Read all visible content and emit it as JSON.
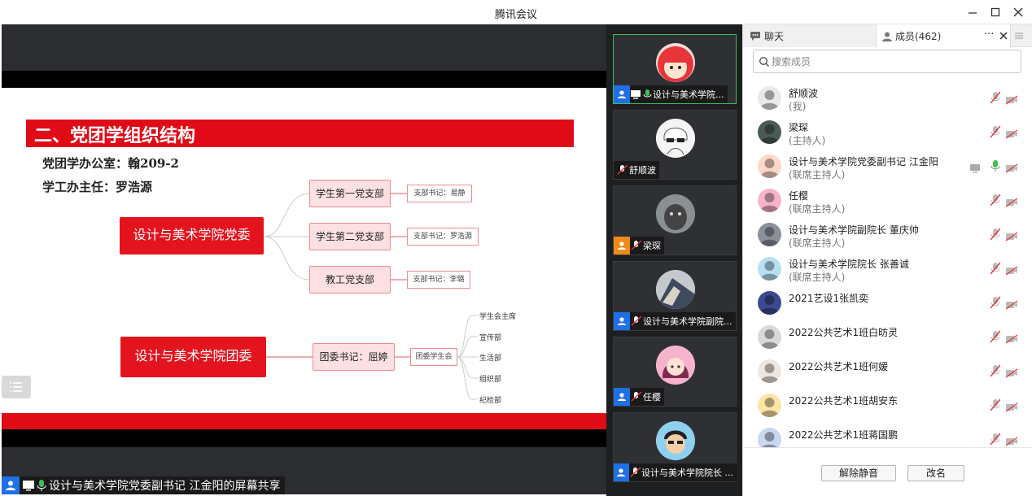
{
  "window": {
    "title": "腾讯会议"
  },
  "slide": {
    "heading": "二、党团学组织结构",
    "office": "党团学办公室：翰209-2",
    "director": "学工办主任：罗浩源",
    "party_committee": "设计与美术学院党委",
    "youth_league": "设计与美术学院团委",
    "branches": [
      {
        "name": "学生第一党支部",
        "secretary": "支部书记：易静"
      },
      {
        "name": "学生第二党支部",
        "secretary": "支部书记：罗浩源"
      },
      {
        "name": "教工党支部",
        "secretary": "支部书记：李璐"
      }
    ],
    "league_secretary": "团委书记：屈婷",
    "student_union": "团委学生会",
    "departments": [
      "学生会主席",
      "宣传部",
      "生活部",
      "组织部",
      "纪检部"
    ]
  },
  "share_label": "设计与美术学院党委副书记  江金阳的屏幕共享",
  "video_tiles": [
    {
      "label": "设计与美术学院..."
    },
    {
      "label": "舒顺波"
    },
    {
      "label": "梁琛"
    },
    {
      "label": "设计与美术学院副院..."
    },
    {
      "label": "任樱"
    },
    {
      "label": "设计与美术学院院长 ..."
    }
  ],
  "panel": {
    "tab_chat": "聊天",
    "tab_members": "成员(462)",
    "search_placeholder": "搜索成员",
    "members": [
      {
        "name": "舒顺波",
        "role": "(我)"
      },
      {
        "name": "梁琛",
        "role": "(主持人)"
      },
      {
        "name": "设计与美术学院党委副书记  江金阳",
        "role": "(联席主持人)"
      },
      {
        "name": "任樱",
        "role": "(联席主持人)"
      },
      {
        "name": "设计与美术学院副院长  董庆帅",
        "role": "(联席主持人)"
      },
      {
        "name": "设计与美术学院院长 张善诚",
        "role": "(联席主持人)"
      },
      {
        "name": "2021艺设1张凯奕",
        "role": ""
      },
      {
        "name": "2022公共艺术1班白昉灵",
        "role": ""
      },
      {
        "name": "2022公共艺术1班何媛",
        "role": ""
      },
      {
        "name": "2022公共艺术1班胡安东",
        "role": ""
      },
      {
        "name": "2022公共艺术1班蒋国鹏",
        "role": ""
      }
    ],
    "unmute_all": "解除静音",
    "rename": "改名"
  },
  "colors": {
    "accent_red": "#e00b17",
    "share_blue": "#1f6fe5",
    "active_green": "#3fbf5a"
  }
}
